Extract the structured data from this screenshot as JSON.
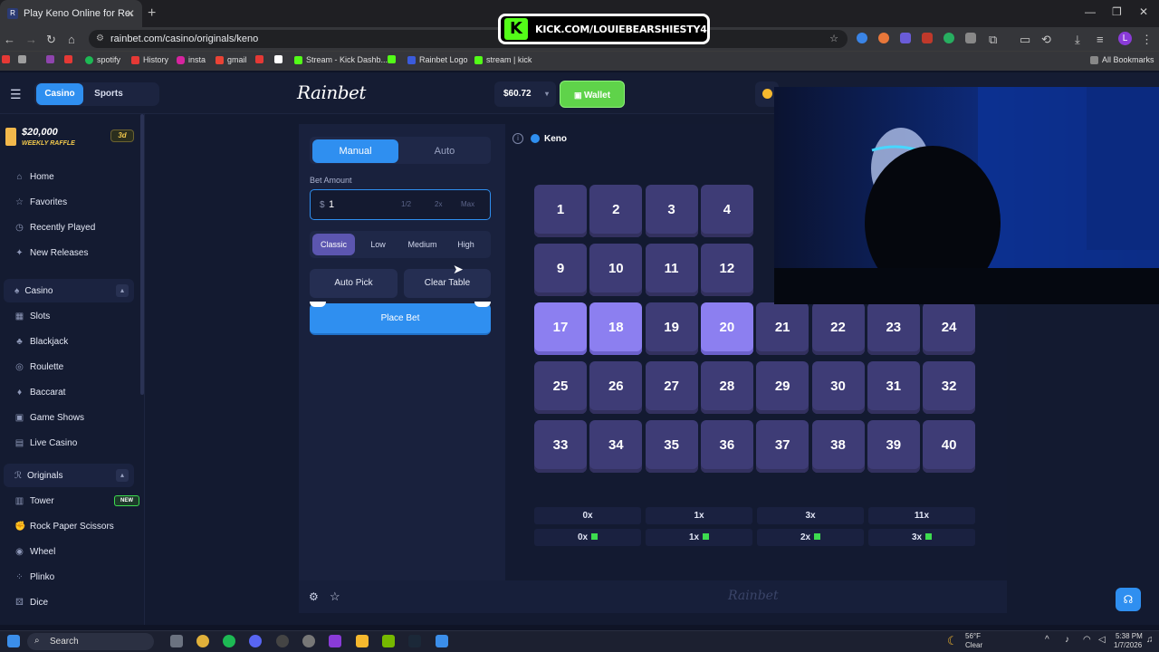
{
  "browser": {
    "tab_title": "Play Keno Online for Real Mone",
    "url": "rainbet.com/casino/originals/keno",
    "profile_initial": "L",
    "bookmarks": [
      "spotify",
      "History",
      "insta",
      "gmail",
      "Stream - Kick Dashb...",
      "Rainbet Logo",
      "stream | kick"
    ],
    "all_bookmarks": "All Bookmarks"
  },
  "overlay": {
    "kick_banner": "KICK.COM/LOUIEBEARSHIESTY4"
  },
  "site": {
    "logo": "Rainbet",
    "tabs": {
      "casino": "Casino",
      "sports": "Sports"
    },
    "balance": "$60.72",
    "wallet": "Wallet",
    "raffle": {
      "amount": "$20,000",
      "label": "WEEKLY RAFFLE",
      "days": "3d"
    },
    "nav": {
      "home": "Home",
      "favorites": "Favorites",
      "recent": "Recently Played",
      "new": "New Releases",
      "casino": "Casino",
      "slots": "Slots",
      "blackjack": "Blackjack",
      "roulette": "Roulette",
      "baccarat": "Baccarat",
      "gameshows": "Game Shows",
      "live": "Live Casino",
      "originals": "Originals",
      "tower": "Tower",
      "tower_badge": "NEW",
      "rps": "Rock Paper Scissors",
      "wheel": "Wheel",
      "plinko": "Plinko",
      "dice": "Dice"
    }
  },
  "keno": {
    "mode_manual": "Manual",
    "mode_auto": "Auto",
    "bet_label": "Bet Amount",
    "currency": "$",
    "bet_value": "1",
    "half": "1/2",
    "double": "2x",
    "max": "Max",
    "risk": [
      "Classic",
      "Low",
      "Medium",
      "High"
    ],
    "risk_selected": "Classic",
    "auto_pick": "Auto Pick",
    "clear_table": "Clear Table",
    "place_bet": "Place Bet",
    "game_title": "Keno",
    "numbers": [
      "1",
      "2",
      "3",
      "4",
      "9",
      "10",
      "11",
      "12",
      "17",
      "18",
      "19",
      "20",
      "21",
      "22",
      "23",
      "24",
      "25",
      "26",
      "27",
      "28",
      "29",
      "30",
      "31",
      "32",
      "33",
      "34",
      "35",
      "36",
      "37",
      "38",
      "39",
      "40"
    ],
    "selected": [
      "17",
      "18",
      "20"
    ],
    "payouts": [
      "0x",
      "1x",
      "3x",
      "11x"
    ],
    "hits": [
      "0x",
      "1x",
      "2x",
      "3x"
    ],
    "footer_logo": "Rainbet"
  },
  "taskbar": {
    "search": "Search",
    "weather_temp": "56°F",
    "weather_desc": "Clear",
    "time": "5:38 PM",
    "date": "1/7/2026"
  },
  "colors": {
    "accent": "#2f8ff0",
    "wallet_green": "#5fd34a",
    "tile": "#3e3c76",
    "tile_selected": "#8c7ff0",
    "kick_green": "#53fc18"
  }
}
